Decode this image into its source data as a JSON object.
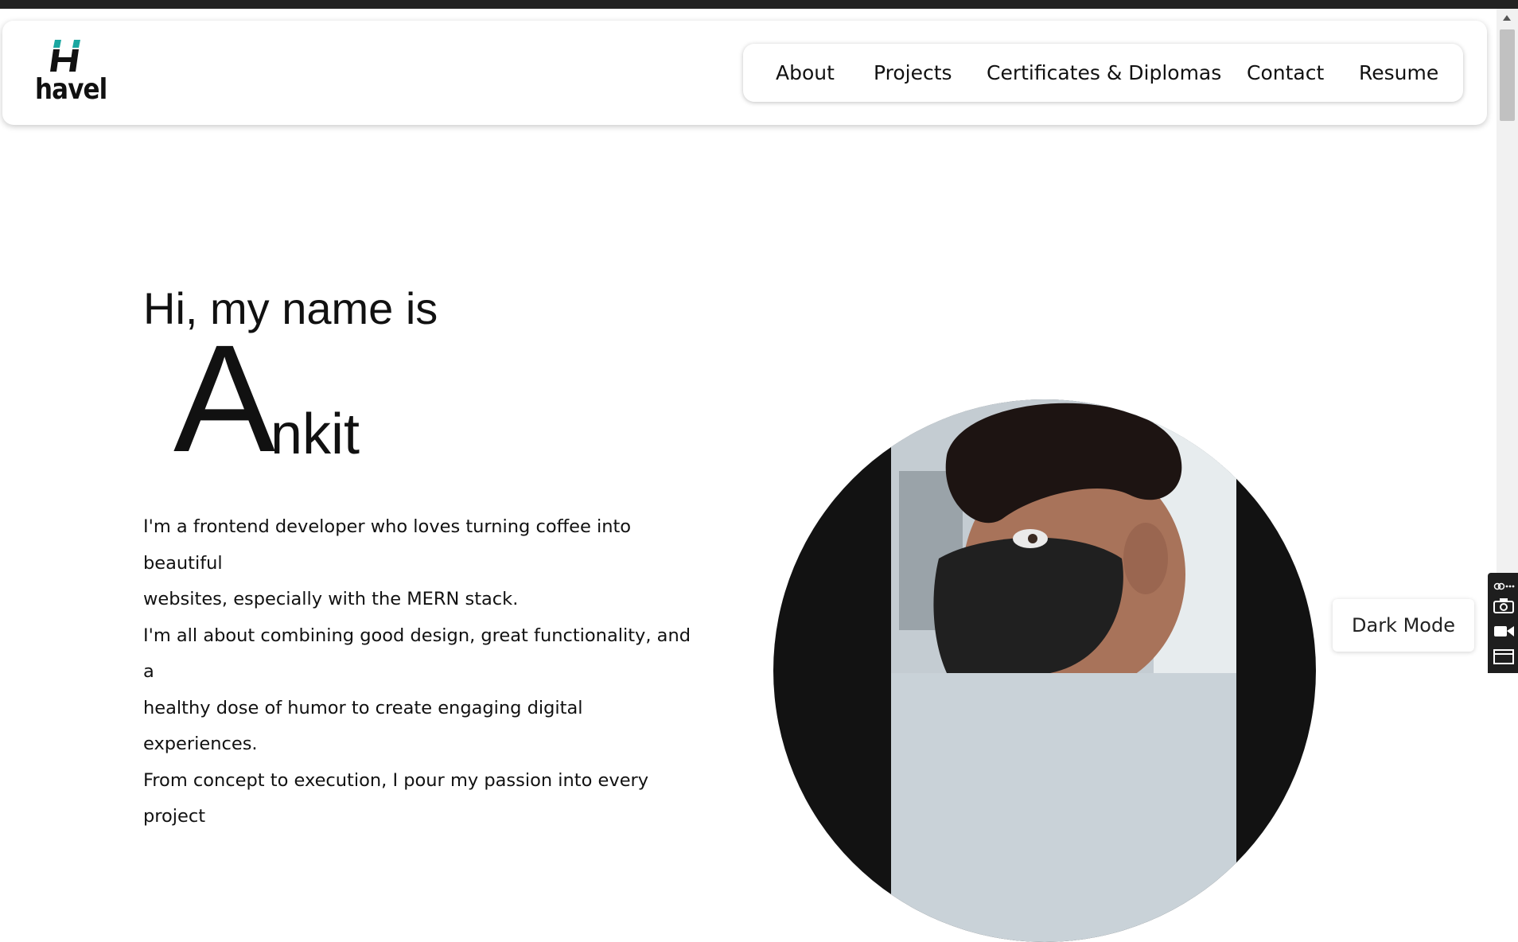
{
  "navbar": {
    "logo_text": "havel",
    "links": [
      "About",
      "Projects",
      "Certificates & Diplomas",
      "Contact",
      "Resume"
    ]
  },
  "hero": {
    "greeting": "Hi, my name is",
    "name_initial": "A",
    "name_rest": "nkit",
    "bio": [
      "I'm a frontend developer who loves turning coffee into beautiful",
      "websites, especially with the MERN stack.",
      "I'm all about combining good design, great functionality, and a",
      "healthy dose of humor to create engaging digital experiences.",
      "From concept to execution, I pour my passion into every project"
    ]
  },
  "dark_mode_button": {
    "label": "Dark Mode"
  },
  "colors": {
    "logo_accent": "#1aa7a1",
    "text": "#111111",
    "photo_bg": "#121212"
  },
  "icons": [
    "logo-h-icon",
    "camera-icon",
    "video-icon",
    "screen-icon",
    "link-icon",
    "more-icon"
  ]
}
